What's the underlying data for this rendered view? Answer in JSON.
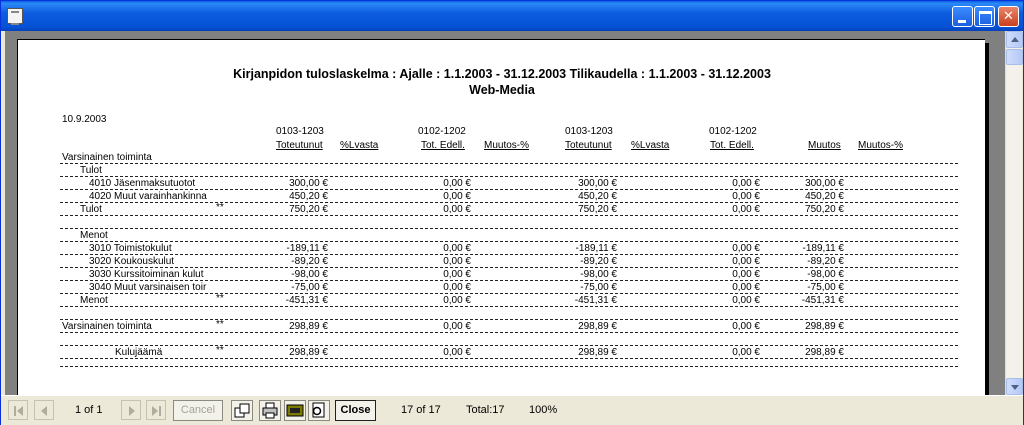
{
  "report": {
    "title": "Kirjanpidon tuloslaskelma : Ajalle : 1.1.2003 - 31.12.2003 Tilikaudella : 1.1.2003 - 31.12.2003",
    "subtitle": "Web-Media",
    "date": "10.9.2003",
    "periods": {
      "p1": "0103-1203",
      "p2": "0102-1202",
      "p3": "0103-1203",
      "p4": "0102-1202"
    },
    "headers": {
      "h1": "Toteutunut",
      "h2": "%Lvasta",
      "h3": "Tot. Edell.",
      "h4": "Muutos-%",
      "h5": "Toteutunut",
      "h6": "%Lvasta",
      "h7": "Tot. Edell.",
      "h8": "Muutos",
      "h9": "Muutos-%"
    },
    "rows": [
      {
        "label": "Varsinainen toiminta",
        "mark": "",
        "v1": "",
        "v2": "",
        "v3": "",
        "v4": "",
        "v5": ""
      },
      {
        "label": "Tulot",
        "mark": "",
        "v1": "",
        "v2": "",
        "v3": "",
        "v4": "",
        "v5": ""
      },
      {
        "label": "4010 Jäsenmaksutuotot",
        "mark": "",
        "v1": "300,00 €",
        "v2": "0,00 €",
        "v3": "300,00 €",
        "v4": "0,00 €",
        "v5": "300,00 €"
      },
      {
        "label": "4020 Muut varainhankinna",
        "mark": "",
        "v1": "450,20 €",
        "v2": "0,00 €",
        "v3": "450,20 €",
        "v4": "0,00 €",
        "v5": "450,20 €"
      },
      {
        "label": "Tulot",
        "mark": "**",
        "v1": "750,20 €",
        "v2": "0,00 €",
        "v3": "750,20 €",
        "v4": "0,00 €",
        "v5": "750,20 €"
      },
      {
        "label": "Menot",
        "mark": "",
        "v1": "",
        "v2": "",
        "v3": "",
        "v4": "",
        "v5": ""
      },
      {
        "label": "3010 Toimistokulut",
        "mark": "",
        "v1": "-189,11 €",
        "v2": "0,00 €",
        "v3": "-189,11 €",
        "v4": "0,00 €",
        "v5": "-189,11 €"
      },
      {
        "label": "3020 Koukouskulut",
        "mark": "",
        "v1": "-89,20 €",
        "v2": "0,00 €",
        "v3": "-89,20 €",
        "v4": "0,00 €",
        "v5": "-89,20 €"
      },
      {
        "label": "3030 Kurssitoiminan kulut",
        "mark": "",
        "v1": "-98,00 €",
        "v2": "0,00 €",
        "v3": "-98,00 €",
        "v4": "0,00 €",
        "v5": "-98,00 €"
      },
      {
        "label": "3040 Muut varsinaisen toir",
        "mark": "",
        "v1": "-75,00 €",
        "v2": "0,00 €",
        "v3": "-75,00 €",
        "v4": "0,00 €",
        "v5": "-75,00 €"
      },
      {
        "label": "Menot",
        "mark": "**",
        "v1": "-451,31 €",
        "v2": "0,00 €",
        "v3": "-451,31 €",
        "v4": "0,00 €",
        "v5": "-451,31 €"
      },
      {
        "label": "Varsinainen toiminta",
        "mark": "**",
        "v1": "298,89 €",
        "v2": "0,00 €",
        "v3": "298,89 €",
        "v4": "0,00 €",
        "v5": "298,89 €"
      },
      {
        "label": "Kulujäämä",
        "mark": "**",
        "v1": "298,89 €",
        "v2": "0,00 €",
        "v3": "298,89 €",
        "v4": "0,00 €",
        "v5": "298,89 €"
      }
    ]
  },
  "toolbar": {
    "page_indicator": "1 of 1",
    "cancel_label": "Cancel",
    "close_label": "Close",
    "record_count": "17 of 17",
    "total": "Total:17",
    "zoom": "100%"
  },
  "icons": {
    "app": "report-app-icon",
    "first": "first-page-icon",
    "prev": "previous-page-icon",
    "next": "next-page-icon",
    "last": "last-page-icon",
    "export": "export-icon",
    "print": "printer-icon",
    "printer_setup": "printer-setup-icon",
    "search": "search-icon"
  }
}
